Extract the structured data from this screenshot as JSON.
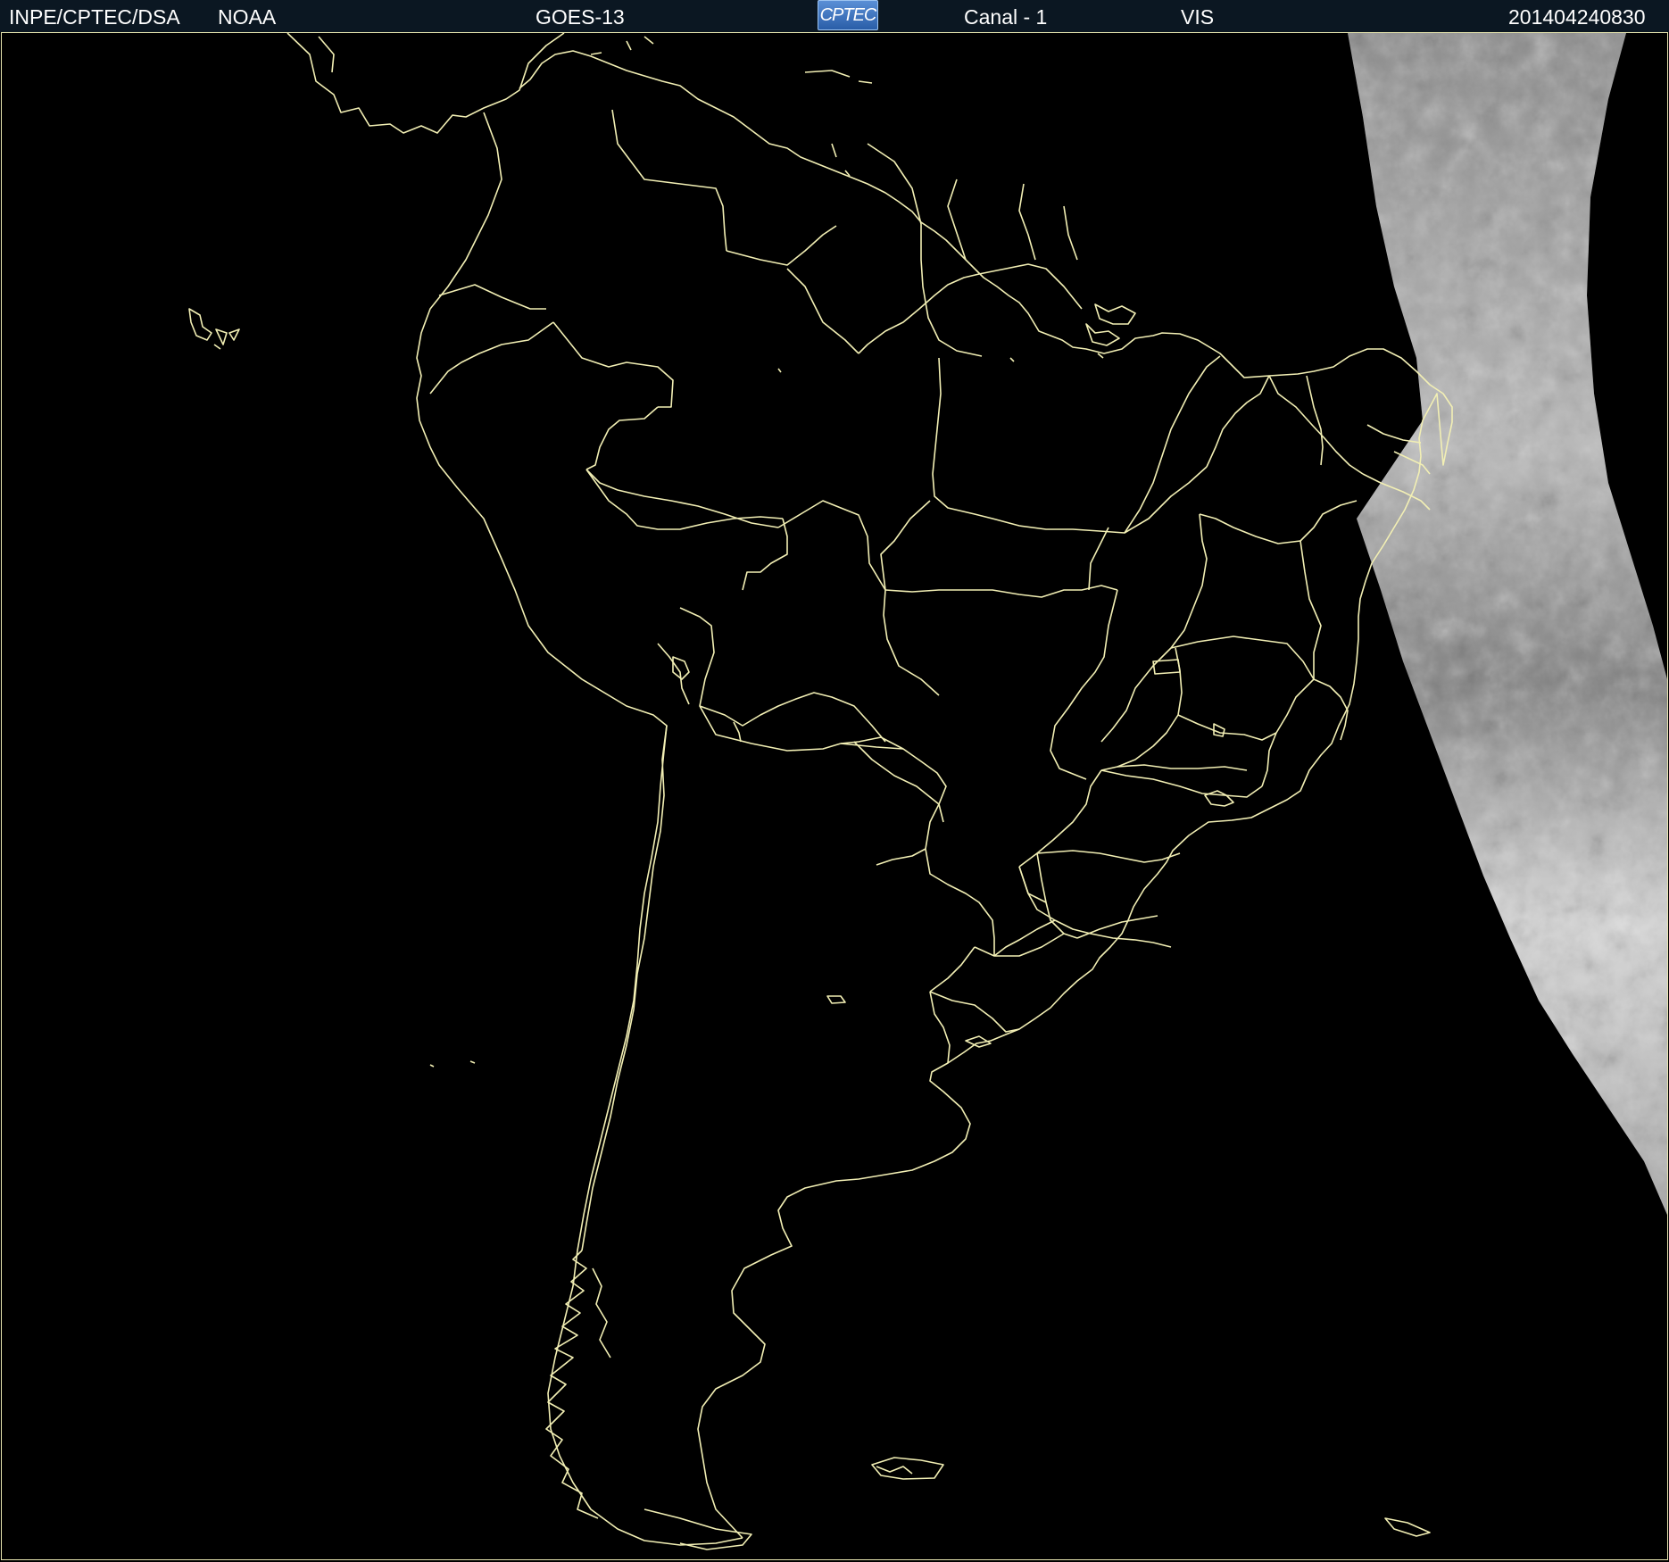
{
  "header": {
    "org": "INPE/CPTEC/DSA",
    "agency": "NOAA",
    "satellite": "GOES-13",
    "logo_text": "CPTEC",
    "channel": "Canal - 1",
    "band": "VIS",
    "timestamp": "201404240830"
  },
  "map": {
    "boundary_color": "#f2efb4",
    "background_color": "#000000",
    "cloud_color": "#9a9a9a"
  }
}
